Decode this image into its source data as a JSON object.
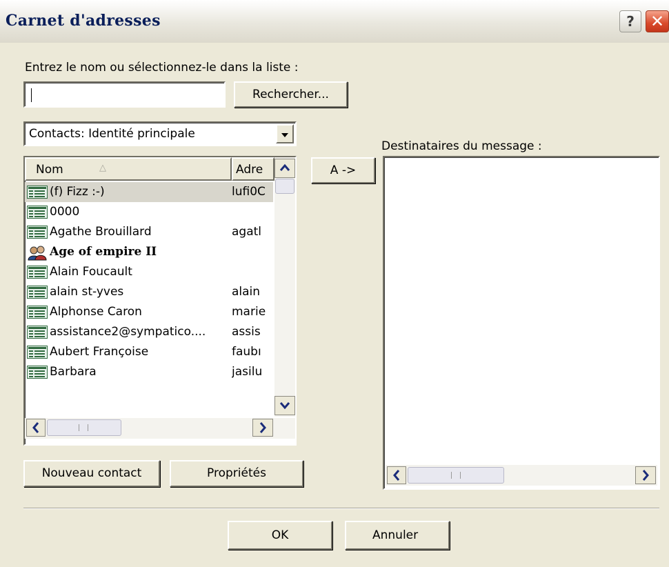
{
  "window": {
    "title": "Carnet d'adresses",
    "help": "?",
    "close": "✕"
  },
  "search": {
    "prompt": "Entrez le nom ou sélectionnez-le dans la liste :",
    "value": "",
    "button": "Rechercher..."
  },
  "source": {
    "selected": "Contacts: Identité principale"
  },
  "list": {
    "columns": [
      "Nom",
      "Adre"
    ],
    "rows": [
      {
        "name": "(f) Fizz :-)",
        "email": "lufi0C",
        "icon": "contact-card-icon",
        "bold": false
      },
      {
        "name": "0000",
        "email": "",
        "icon": "contact-card-icon",
        "bold": false
      },
      {
        "name": "Agathe Brouillard",
        "email": "agatl",
        "icon": "contact-card-icon",
        "bold": false
      },
      {
        "name": "Age of empire II",
        "email": "",
        "icon": "contact-group-icon",
        "bold": true
      },
      {
        "name": "Alain Foucault",
        "email": "",
        "icon": "contact-card-icon",
        "bold": false
      },
      {
        "name": "alain st-yves",
        "email": "alain",
        "icon": "contact-card-icon",
        "bold": false
      },
      {
        "name": "Alphonse Caron",
        "email": "marie",
        "icon": "contact-card-icon",
        "bold": false
      },
      {
        "name": "assistance2@sympatico....",
        "email": "assis",
        "icon": "contact-card-icon",
        "bold": false
      },
      {
        "name": "Aubert Françoise",
        "email": "faubı",
        "icon": "contact-card-icon",
        "bold": false
      },
      {
        "name": "Barbara",
        "email": "jasilu",
        "icon": "contact-card-icon",
        "bold": false
      }
    ]
  },
  "buttons": {
    "to": "A ->",
    "new_contact": "Nouveau contact",
    "properties": "Propriétés",
    "ok": "OK",
    "cancel": "Annuler"
  },
  "recipients": {
    "label": "Destinataires du message :"
  }
}
